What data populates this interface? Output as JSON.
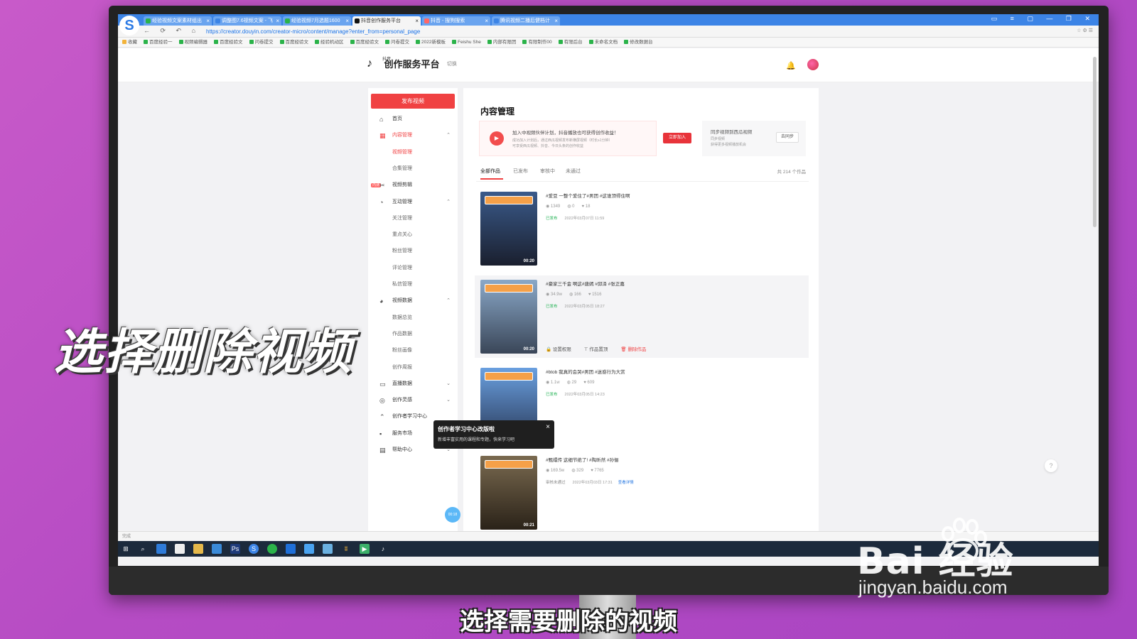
{
  "browser": {
    "tabs": [
      {
        "label": "经验视频文案素材组出"
      },
      {
        "label": "调整图7.6视频文案 - 飞"
      },
      {
        "label": "经验视频7月选题1600"
      },
      {
        "label": "抖音创作服务平台",
        "active": true
      },
      {
        "label": "抖音 - 搜狗搜索"
      },
      {
        "label": "腾讯视频二播后健档计"
      }
    ],
    "url": "https://creator.douyin.com/creator-micro/content/manage?enter_from=personal_page",
    "bookmarks": [
      "收藏",
      "百度经验一",
      "视频编辑器",
      "百度经验文",
      "问卷提交",
      "百度经验文",
      "经验机动区",
      "百度经验文",
      "问卷提交",
      "2022新模板",
      "Feishu She",
      "内部有限团",
      "有限制作00",
      "有限后台",
      "未命名文档",
      "修改数据台"
    ],
    "status": "完成"
  },
  "header": {
    "logo_small": "抖音",
    "logo_text": "创作服务平台",
    "switch_label": "切换"
  },
  "sidebar": {
    "publish_label": "发布视频",
    "items": [
      {
        "label": "首页",
        "icon": "home-icon"
      },
      {
        "label": "内容管理",
        "icon": "grid-icon",
        "active": true,
        "expanded": true
      },
      {
        "label": "视频管理",
        "sub": true,
        "active": true
      },
      {
        "label": "合集管理",
        "sub": true
      },
      {
        "label": "视频剪辑",
        "icon": "scissors-icon",
        "badge": "内测"
      },
      {
        "label": "互动管理",
        "icon": "chat-icon",
        "expanded": true
      },
      {
        "label": "关注管理",
        "sub": true
      },
      {
        "label": "重点关心",
        "sub": true
      },
      {
        "label": "粉丝管理",
        "sub": true
      },
      {
        "label": "评论管理",
        "sub": true
      },
      {
        "label": "私信管理",
        "sub": true
      },
      {
        "label": "视频数据",
        "icon": "pie-chart-icon",
        "expanded": true
      },
      {
        "label": "数据总览",
        "sub": true
      },
      {
        "label": "作品数据",
        "sub": true
      },
      {
        "label": "粉丝画像",
        "sub": true
      },
      {
        "label": "创作周报",
        "sub": true
      },
      {
        "label": "直播数据",
        "icon": "monitor-icon"
      },
      {
        "label": "创作灵感",
        "icon": "lightbulb-icon"
      },
      {
        "label": "创作者学习中心",
        "icon": "graduation-icon"
      },
      {
        "label": "服务市场",
        "icon": "apps-icon"
      },
      {
        "label": "帮助中心",
        "icon": "help-book-icon"
      }
    ]
  },
  "content": {
    "title": "内容管理",
    "banner": {
      "line1": "加入中视频伙伴计划，抖音播放也可获得创作收益！",
      "line2": "成功加入计划后，通过西瓜视频发布新横屏视频（时长≥1分钟）",
      "line3": "可享受西瓜视频、抖音、今日头条的创作收益",
      "join_label": "立即加入"
    },
    "sync": {
      "line1": "同步视频到西瓜视频",
      "line2": "同步视频",
      "line3": "获得更多视频播放机会",
      "button": "去同步"
    },
    "tabs": [
      {
        "label": "全部作品",
        "active": true
      },
      {
        "label": "已发布"
      },
      {
        "label": "审核中"
      },
      {
        "label": "未通过"
      }
    ],
    "count": "共 214 个作品",
    "videos": [
      {
        "title": "#爱豆 一整个爱住了#男团 #这谁顶得住啊",
        "views": "1349",
        "comments": "0",
        "likes": "18",
        "status": "已发布",
        "date": "2022年03月07日 11:59",
        "duration": "00:20",
        "colors": [
          "#3a5a8a",
          "#1a1f2e"
        ]
      },
      {
        "title": "#豪家三千金 啊这#唐嫣 #邱泽 #张正嘉",
        "views": "34.9w",
        "comments": "166",
        "likes": "1516",
        "status": "已发布",
        "date": "2022年03月05日 18:27",
        "duration": "00:20",
        "colors": [
          "#8aa8c8",
          "#3a4658"
        ],
        "hovered": true
      },
      {
        "title": "#btob 我真的会哭#男团 #迷惑行为大赏",
        "views": "1.1w",
        "comments": "29",
        "likes": "609",
        "status": "已发布",
        "date": "2022年03月05日 14:23",
        "duration": "00:18",
        "colors": [
          "#6aa0e0",
          "#2a3a5a"
        ]
      },
      {
        "title": "#甄嬛传 这细节绝了! #陶昕然 #孙俪",
        "views": "169.5w",
        "comments": "329",
        "likes": "7765",
        "status": "审核未通过",
        "date": "2022年03月03日 17:31",
        "detail_link": "查看详情",
        "duration": "00:21",
        "colors": [
          "#7a6a50",
          "#2a2218"
        ]
      }
    ],
    "actions": {
      "permission": "设置权限",
      "pin": "作品置顶",
      "delete": "删除作品"
    }
  },
  "tooltip": {
    "title": "创作者学习中心改版啦",
    "desc": "新增丰富实用的课程和专题，快来学习吧",
    "close": "×"
  },
  "float_badge": "00:18",
  "overlay": {
    "caption": "选择删除视频",
    "subtitle": "选择需要删除的视频"
  },
  "watermark": {
    "brand": "Bai 经验",
    "url": "jingyan.baidu.com"
  }
}
